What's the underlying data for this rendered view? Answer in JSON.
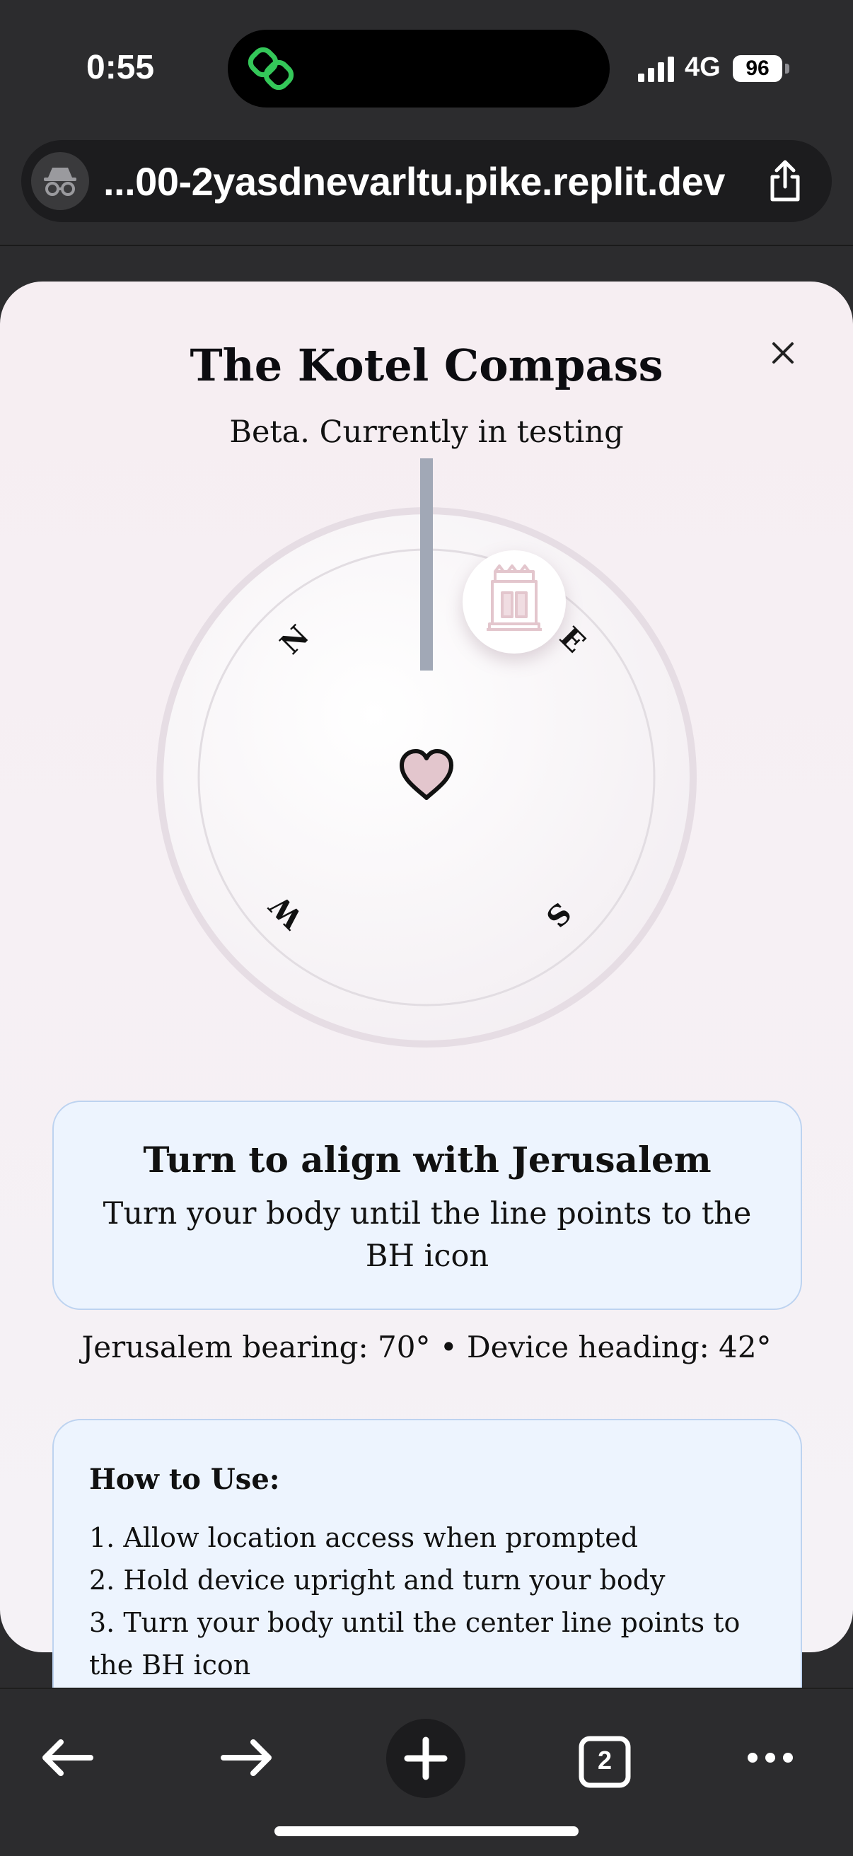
{
  "status_bar": {
    "time": "0:55",
    "network": "4G",
    "battery": "96"
  },
  "browser": {
    "url": "...00-2yasdnevarltu.pike.replit.dev",
    "tab_count": "2"
  },
  "modal": {
    "title": "The Kotel Compass",
    "subtitle": "Beta. Currently in testing",
    "compass": {
      "north": "N",
      "east": "E",
      "south": "S",
      "west": "W"
    },
    "alignment": {
      "title": "Turn to align with Jerusalem",
      "instruction": "Turn your body until the line points to the BH icon"
    },
    "bearing_text": "Jerusalem bearing: 70° • Device heading: 42°",
    "how_to_use": {
      "title": "How to Use:",
      "steps": [
        "1. Allow location access when prompted",
        "2. Hold device upright and turn your body",
        "3. Turn your body until the center line points to the BH icon"
      ]
    }
  },
  "colors": {
    "card_bg": "#f6eef2",
    "info_box": "#edf4fe",
    "info_border": "#bdd3f0",
    "needle": "#a1a8b6",
    "accent_pink": "#e3c6cd"
  }
}
